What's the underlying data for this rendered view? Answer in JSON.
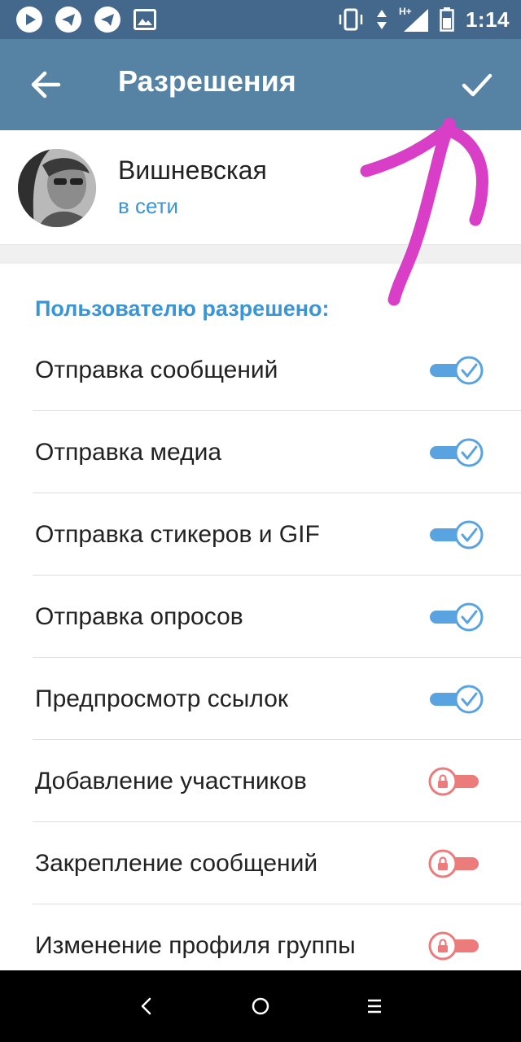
{
  "status_bar": {
    "time": "1:14",
    "network_label": "H+",
    "icons": [
      "play-app-icon",
      "telegram-icon",
      "telegram-icon",
      "image-icon",
      "vibrate-icon",
      "data-arrows-icon",
      "signal-icon",
      "battery-icon"
    ]
  },
  "header": {
    "title": "Разрешения",
    "back_icon": "arrow-left-icon",
    "done_icon": "checkmark-icon"
  },
  "profile": {
    "name": "Вишневская",
    "status": "в сети"
  },
  "permissions": {
    "section_title": "Пользователю разрешено:",
    "items": [
      {
        "label": "Отправка сообщений",
        "enabled": true,
        "locked": false
      },
      {
        "label": "Отправка медиа",
        "enabled": true,
        "locked": false
      },
      {
        "label": "Отправка стикеров и GIF",
        "enabled": true,
        "locked": false
      },
      {
        "label": "Отправка опросов",
        "enabled": true,
        "locked": false
      },
      {
        "label": "Предпросмотр ссылок",
        "enabled": true,
        "locked": false
      },
      {
        "label": "Добавление участников",
        "enabled": false,
        "locked": true
      },
      {
        "label": "Закрепление сообщений",
        "enabled": false,
        "locked": true
      },
      {
        "label": "Изменение профиля группы",
        "enabled": false,
        "locked": true
      }
    ]
  },
  "colors": {
    "status_bar": "#44688c",
    "header": "#5682a3",
    "accent_blue": "#3a95d5",
    "toggle_on": "#59a3e0",
    "toggle_off": "#ec7c7c",
    "annotation": "#d93ec6"
  },
  "nav_bar": {
    "icons": [
      "back-triangle-icon",
      "home-circle-icon",
      "recents-menu-icon"
    ]
  }
}
